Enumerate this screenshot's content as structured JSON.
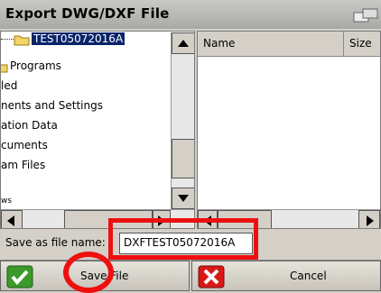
{
  "window": {
    "title": "Export DWG/DXF File"
  },
  "tree": {
    "items": [
      {
        "label": "TEST05072016A",
        "selected": true
      },
      {
        "label": "Programs"
      },
      {
        "label": "led"
      },
      {
        "label": "nents and Settings"
      },
      {
        "label": "ation Data"
      },
      {
        "label": "cuments"
      },
      {
        "label": "am Files"
      },
      {
        "label": "ws"
      }
    ]
  },
  "list": {
    "columns": [
      "Name",
      "Size"
    ]
  },
  "save": {
    "label": "Save as file name:",
    "filename": "DXFTEST05072016A"
  },
  "buttons": {
    "save_label": "Save File",
    "cancel_label": "Cancel"
  },
  "colors": {
    "selection": "#0a246a",
    "annotation": "#ee1010",
    "check": "#3a9a2a",
    "cancel": "#d81818"
  }
}
